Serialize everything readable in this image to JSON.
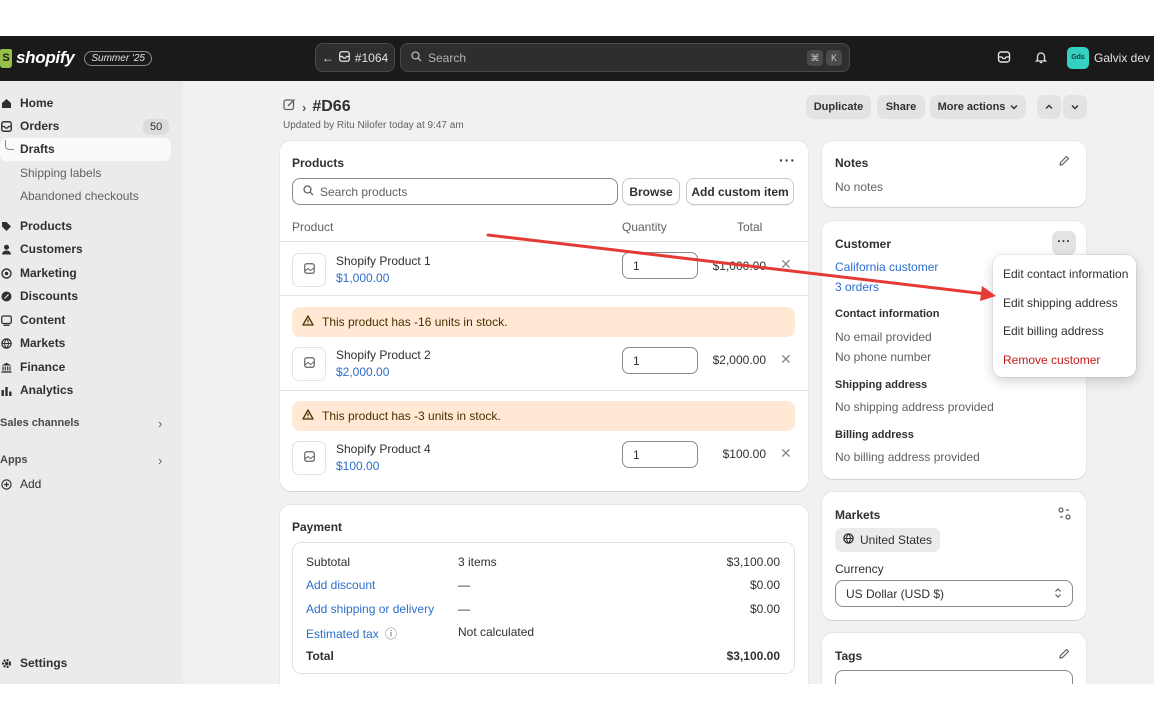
{
  "topbar": {
    "logo_text": "shopify",
    "edition": "Summer '25",
    "nav_label": "#1064",
    "search_placeholder": "Search",
    "kbd_cmd": "⌘",
    "kbd_k": "K",
    "store_initials": "Gds",
    "store_name": "Galvix dev st"
  },
  "sidebar": {
    "home": "Home",
    "orders": "Orders",
    "orders_count": "50",
    "drafts": "Drafts",
    "shipping_labels": "Shipping labels",
    "abandoned": "Abandoned checkouts",
    "products": "Products",
    "customers": "Customers",
    "marketing": "Marketing",
    "discounts": "Discounts",
    "content": "Content",
    "markets": "Markets",
    "finance": "Finance",
    "analytics": "Analytics",
    "sales_channels": "Sales channels",
    "apps": "Apps",
    "add": "Add",
    "settings": "Settings"
  },
  "header": {
    "title": "#D66",
    "subtitle": "Updated by Ritu Nilofer today at 9:47 am",
    "duplicate": "Duplicate",
    "share": "Share",
    "more_actions": "More actions"
  },
  "products_card": {
    "title": "Products",
    "search_placeholder": "Search products",
    "browse": "Browse",
    "add_custom": "Add custom item",
    "col_product": "Product",
    "col_quantity": "Quantity",
    "col_total": "Total",
    "items": [
      {
        "name": "Shopify Product 1",
        "price": "$1,000.00",
        "qty": "1",
        "total": "$1,000.00",
        "warning": ""
      },
      {
        "name": "Shopify Product 2",
        "price": "$2,000.00",
        "qty": "1",
        "total": "$2,000.00",
        "warning": "This product has -16 units in stock."
      },
      {
        "name": "Shopify Product 4",
        "price": "$100.00",
        "qty": "1",
        "total": "$100.00",
        "warning": "This product has -3 units in stock."
      }
    ]
  },
  "payment": {
    "title": "Payment",
    "subtotal": "Subtotal",
    "subtotal_items": "3 items",
    "subtotal_value": "$3,100.00",
    "add_discount": "Add discount",
    "discount_dash": "—",
    "discount_value": "$0.00",
    "add_shipping": "Add shipping or delivery",
    "shipping_dash": "—",
    "shipping_value": "$0.00",
    "estimated_tax": "Estimated tax",
    "tax_note": "Not calculated",
    "total": "Total",
    "total_value": "$3,100.00"
  },
  "notes": {
    "title": "Notes",
    "text": "No notes"
  },
  "customer": {
    "title": "Customer",
    "name": "California customer",
    "orders": "3 orders",
    "contact_heading": "Contact information",
    "email": "No email provided",
    "phone": "No phone number",
    "shipping_heading": "Shipping address",
    "shipping": "No shipping address provided",
    "billing_heading": "Billing address",
    "billing": "No billing address provided"
  },
  "menu": {
    "edit_contact": "Edit contact information",
    "edit_shipping": "Edit shipping address",
    "edit_billing": "Edit billing address",
    "remove": "Remove customer"
  },
  "markets": {
    "title": "Markets",
    "market": "United States",
    "currency_label": "Currency",
    "currency": "US Dollar (USD $)"
  },
  "tags": {
    "title": "Tags"
  },
  "colors": {
    "topbar": "#1a1a1a",
    "link": "#2c6ecb",
    "danger": "#c71b1b",
    "warning_bg": "#ffe9d5",
    "annotation_arrow": "#e53935"
  }
}
